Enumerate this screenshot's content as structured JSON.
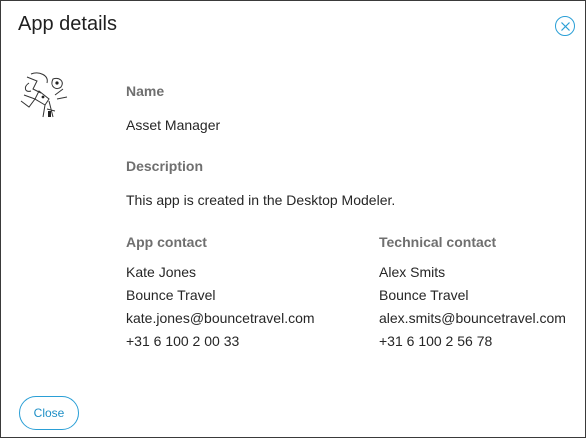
{
  "dialog": {
    "title": "App details",
    "close_icon": "close-circle-icon",
    "close_button_label": "Close"
  },
  "app": {
    "icon": "app-sketch-icon",
    "name_label": "Name",
    "name": "Asset Manager",
    "description_label": "Description",
    "description": "This app is created in the Desktop Modeler."
  },
  "app_contact": {
    "label": "App contact",
    "name": "Kate Jones",
    "company": "Bounce Travel",
    "email": "kate.jones@bouncetravel.com",
    "phone": "+31 6 100 2 00 33"
  },
  "technical_contact": {
    "label": "Technical contact",
    "name": "Alex Smits",
    "company": "Bounce Travel",
    "email": "alex.smits@bouncetravel.com",
    "phone": "+31 6 100 2 56 78"
  },
  "colors": {
    "accent": "#2a9fd6",
    "label": "#6f6f6f",
    "text": "#262626"
  }
}
